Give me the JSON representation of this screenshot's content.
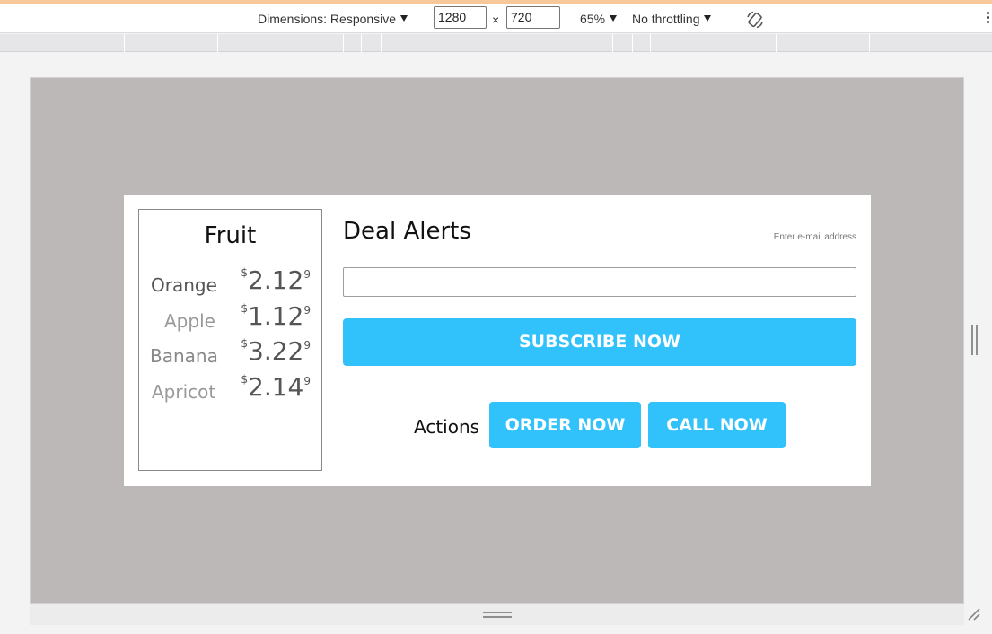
{
  "toolbar": {
    "dimensions_label": "Dimensions: Responsive",
    "width_value": "1280",
    "times_sign": "×",
    "height_value": "720",
    "zoom": "65%",
    "throttling": "No throttling",
    "rotate_icon": "rotate-icon",
    "more_icon": "more-vertical-icon"
  },
  "fruit": {
    "title": "Fruit",
    "items": [
      {
        "name": "Orange",
        "currency": "$",
        "price": "2.12",
        "fraction": "9",
        "name_color": "#555555"
      },
      {
        "name": "Apple",
        "currency": "$",
        "price": "1.12",
        "fraction": "9",
        "name_color": "#999999"
      },
      {
        "name": "Banana",
        "currency": "$",
        "price": "3.22",
        "fraction": "9",
        "name_color": "#888888"
      },
      {
        "name": "Apricot",
        "currency": "$",
        "price": "2.14",
        "fraction": "9",
        "name_color": "#999999"
      }
    ]
  },
  "deals": {
    "title": "Deal Alerts",
    "email_hint": "Enter e-mail address",
    "email_value": "",
    "subscribe_label": "SUBSCRIBE NOW",
    "actions_label": "Actions",
    "order_label": "ORDER NOW",
    "call_label": "CALL NOW"
  },
  "colors": {
    "accent": "#31c2fc",
    "viewport_background": "#bdb8b8",
    "card_background": "#ffffff"
  }
}
